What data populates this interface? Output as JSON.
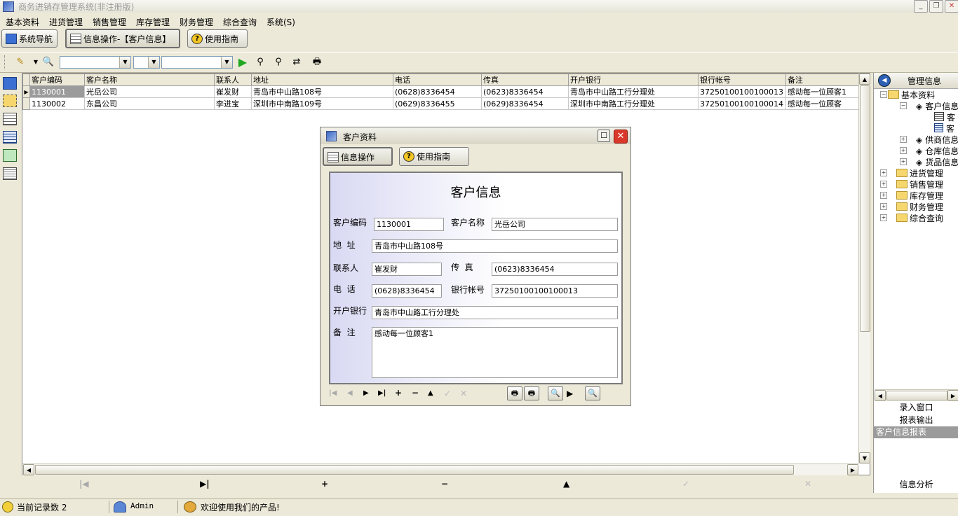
{
  "window": {
    "title": "商务进销存管理系统(非注册版)"
  },
  "menu": [
    "基本资料",
    "进货管理",
    "销售管理",
    "库存管理",
    "财务管理",
    "综合查询",
    "系统(S)"
  ],
  "tabs": {
    "nav": "系统导航",
    "info": "信息操作-【客户信息】",
    "guide": "使用指南"
  },
  "grid": {
    "columns": [
      "客户编码",
      "客户名称",
      "联系人",
      "地址",
      "电话",
      "传真",
      "开户银行",
      "银行帐号",
      "备注"
    ],
    "rows": [
      [
        "1130001",
        "光岳公司",
        "崔发财",
        "青岛市中山路108号",
        "(0628)8336454",
        "(0623)8336454",
        "青岛市中山路工行分理处",
        "37250100100100013",
        "感动每一位顾客1"
      ],
      [
        "1130002",
        "东昌公司",
        "李进宝",
        "深圳市中南路109号",
        "(0629)8336455",
        "(0629)8336454",
        "深圳市中南路工行分理处",
        "37250100100100014",
        "感动每一位顾客"
      ]
    ]
  },
  "right_panel": {
    "title": "管理信息",
    "tree": {
      "root": "基本资料",
      "customer": "客户信息",
      "customer_child1": "客",
      "customer_child2": "客",
      "supplier": "供商信息",
      "warehouse": "仓库信息",
      "goods": "货品信息",
      "purchase": "进货管理",
      "sales": "销售管理",
      "inventory": "库存管理",
      "finance": "财务管理",
      "query": "综合查询"
    },
    "items": [
      "录入窗口",
      "报表输出",
      "客户信息报表"
    ],
    "footer": "信息分析"
  },
  "dialog": {
    "title": "客户资料",
    "tab_info": "信息操作",
    "tab_guide": "使用指南",
    "heading": "客户信息",
    "labels": {
      "code": "客户编码",
      "name": "客户名称",
      "address": "地  址",
      "contact": "联系人",
      "fax": "传  真",
      "phone": "电  话",
      "account": "银行帐号",
      "bank": "开户银行",
      "remark": "备  注"
    },
    "values": {
      "code": "1130001",
      "name": "光岳公司",
      "address": "青岛市中山路108号",
      "contact": "崔发财",
      "fax": "(0623)8336454",
      "phone": "(0628)8336454",
      "account": "37250100100100013",
      "bank": "青岛市中山路工行分理处",
      "remark": "感动每一位顾客1"
    }
  },
  "status": {
    "record_count": "当前记录数 2",
    "user": "Admin",
    "welcome": "欢迎使用我们的产品!"
  },
  "colors": {
    "background": "#ece9d8",
    "selected_cell": "#9b9b9b",
    "close_button": "#d9382a",
    "form_gradient": "#d9d9f3"
  }
}
